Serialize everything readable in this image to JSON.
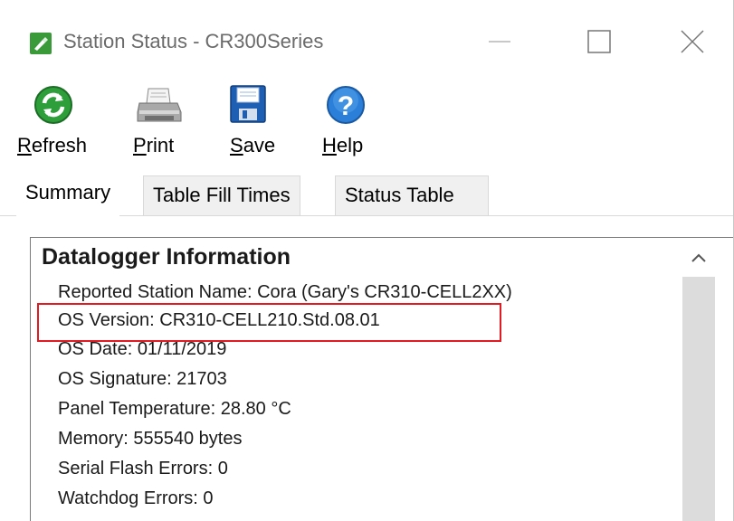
{
  "window": {
    "title": "Station Status - CR300Series",
    "controls": {
      "minimize": "minimize-icon",
      "maximize": "maximize-icon",
      "close": "close-icon"
    }
  },
  "toolbar": {
    "buttons": [
      {
        "name": "refresh",
        "accel": "R",
        "rest": "efresh",
        "icon": "refresh-icon"
      },
      {
        "name": "print",
        "accel": "P",
        "rest": "rint",
        "icon": "printer-icon"
      },
      {
        "name": "save",
        "accel": "S",
        "rest": "ave",
        "icon": "floppy-disk-icon"
      },
      {
        "name": "help",
        "accel": "H",
        "rest": "elp",
        "icon": "help-icon"
      }
    ]
  },
  "tabs": [
    {
      "label": "Summary",
      "active": true
    },
    {
      "label": "Table Fill Times",
      "active": false
    },
    {
      "label": "Status Table",
      "active": false
    }
  ],
  "summary": {
    "section_title": "Datalogger Information",
    "lines": [
      "Reported Station Name: Cora (Gary's CR310-CELL2XX)",
      "OS Version: CR310-CELL210.Std.08.01",
      "OS Date: 01/11/2019",
      "OS Signature: 21703",
      "Panel Temperature: 28.80 °C",
      "Memory: 555540 bytes",
      "Serial Flash Errors: 0",
      "Watchdog Errors: 0"
    ],
    "highlighted_line": "OS Version: CR310-CELL210.Std.08.01"
  },
  "colors": {
    "highlight": "#e21b23",
    "refresh_green": "#2e9e3a",
    "help_blue": "#2b7fd8",
    "save_blue": "#1f5fb3"
  }
}
